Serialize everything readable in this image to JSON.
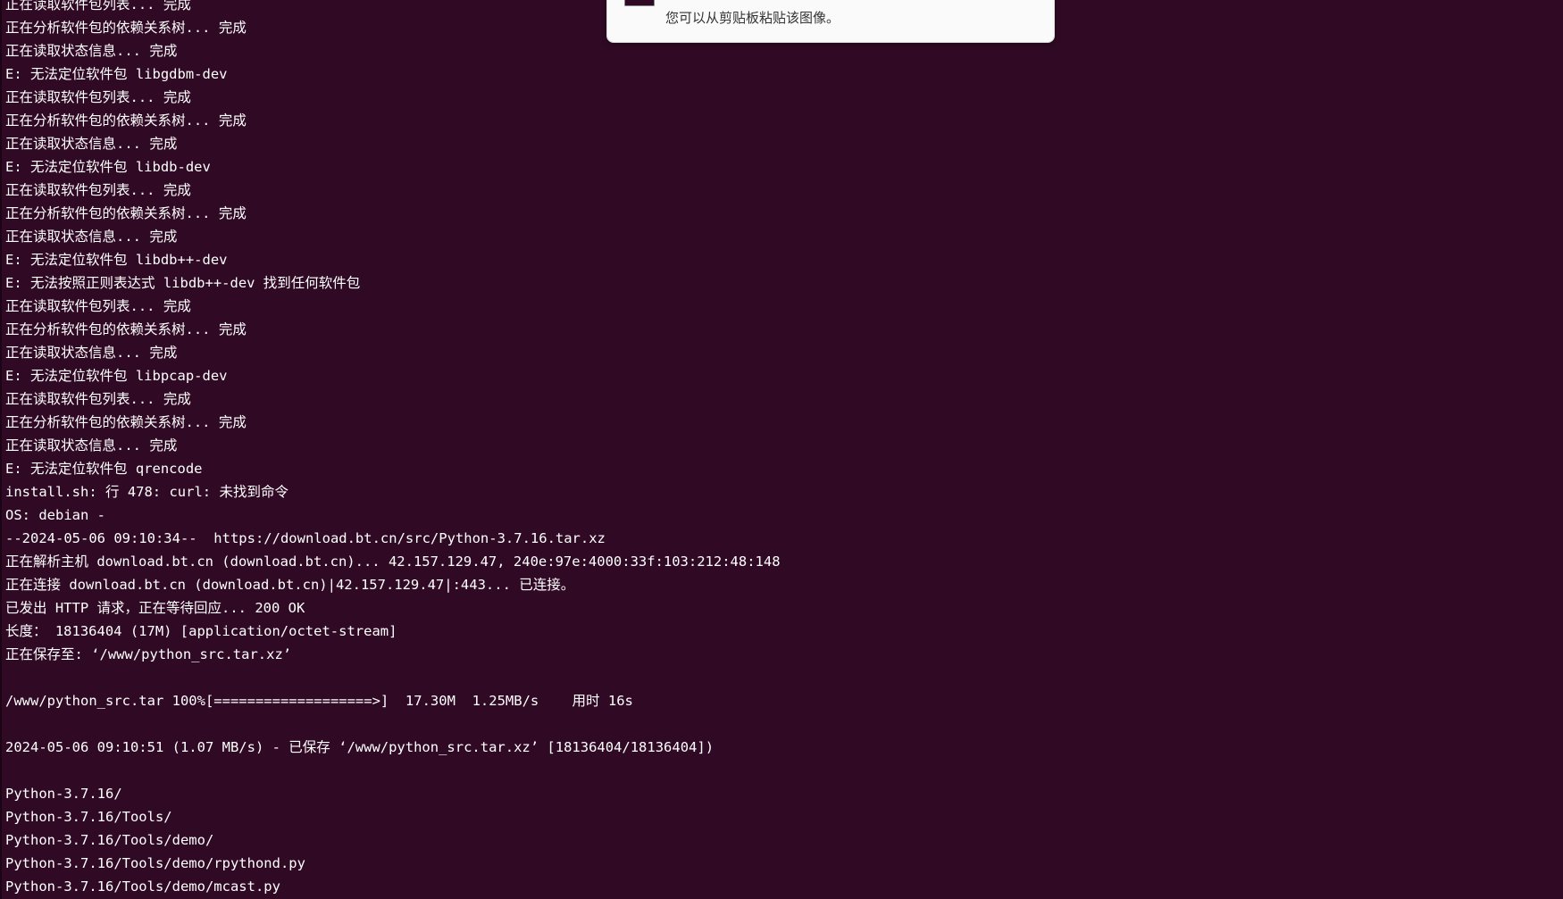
{
  "colors": {
    "terminal_background": "#300a24",
    "terminal_text": "#ffffff",
    "notification_background": "#fafafa",
    "notification_text": "#333333"
  },
  "notification": {
    "icon": "screenshot-thumbnail-icon",
    "message": "您可以从剪贴板粘贴该图像。"
  },
  "terminal": {
    "lines": [
      "正在读取软件包列表... 完成",
      "正在分析软件包的依赖关系树... 完成",
      "正在读取状态信息... 完成",
      "E: 无法定位软件包 libgdbm-dev",
      "正在读取软件包列表... 完成",
      "正在分析软件包的依赖关系树... 完成",
      "正在读取状态信息... 完成",
      "E: 无法定位软件包 libdb-dev",
      "正在读取软件包列表... 完成",
      "正在分析软件包的依赖关系树... 完成",
      "正在读取状态信息... 完成",
      "E: 无法定位软件包 libdb++-dev",
      "E: 无法按照正则表达式 libdb++-dev 找到任何软件包",
      "正在读取软件包列表... 完成",
      "正在分析软件包的依赖关系树... 完成",
      "正在读取状态信息... 完成",
      "E: 无法定位软件包 libpcap-dev",
      "正在读取软件包列表... 完成",
      "正在分析软件包的依赖关系树... 完成",
      "正在读取状态信息... 完成",
      "E: 无法定位软件包 qrencode",
      "install.sh: 行 478: curl: 未找到命令",
      "OS: debian -",
      "--2024-05-06 09:10:34--  https://download.bt.cn/src/Python-3.7.16.tar.xz",
      "正在解析主机 download.bt.cn (download.bt.cn)... 42.157.129.47, 240e:97e:4000:33f:103:212:48:148",
      "正在连接 download.bt.cn (download.bt.cn)|42.157.129.47|:443... 已连接。",
      "已发出 HTTP 请求，正在等待回应... 200 OK",
      "长度： 18136404 (17M) [application/octet-stream]",
      "正在保存至: ‘/www/python_src.tar.xz’",
      "",
      "/www/python_src.tar 100%[===================>]  17.30M  1.25MB/s    用时 16s",
      "",
      "2024-05-06 09:10:51 (1.07 MB/s) - 已保存 ‘/www/python_src.tar.xz’ [18136404/18136404])",
      "",
      "Python-3.7.16/",
      "Python-3.7.16/Tools/",
      "Python-3.7.16/Tools/demo/",
      "Python-3.7.16/Tools/demo/rpythond.py",
      "Python-3.7.16/Tools/demo/mcast.py"
    ]
  }
}
